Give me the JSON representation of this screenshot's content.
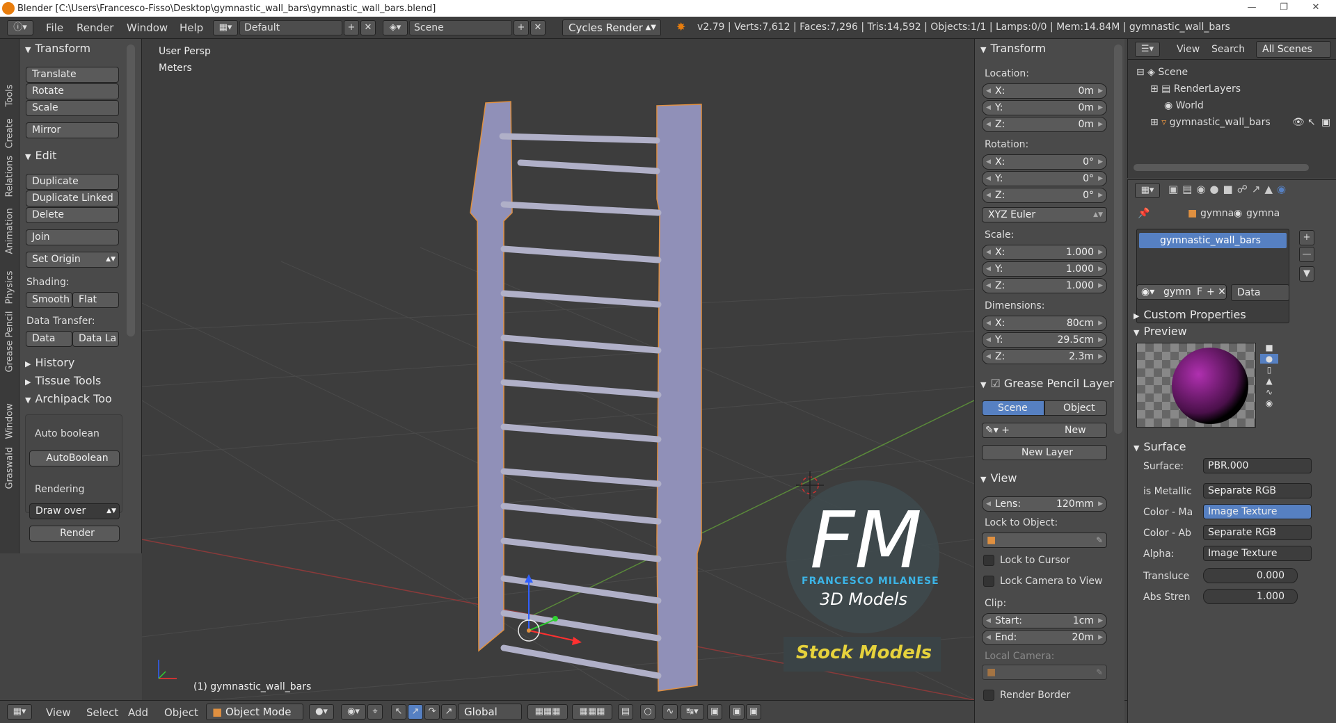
{
  "window": {
    "title": "Blender [C:\\Users\\Francesco-Fisso\\Desktop\\gymnastic_wall_bars\\gymnastic_wall_bars.blend]"
  },
  "menubar": {
    "items": [
      "File",
      "Render",
      "Window",
      "Help"
    ],
    "layout": "Default",
    "scene": "Scene",
    "engine": "Cycles Render",
    "stats": "v2.79 | Verts:7,612 | Faces:7,296 | Tris:14,592 | Objects:1/1 | Lamps:0/0 | Mem:14.84M | gymnastic_wall_bars"
  },
  "left_tabs": [
    "Tools",
    "Create",
    "Relations",
    "Animation",
    "Physics",
    "Grease Pencil",
    "Window",
    "Graswald"
  ],
  "tools": {
    "transform": {
      "title": "Transform",
      "buttons": [
        "Translate",
        "Rotate",
        "Scale",
        "Mirror"
      ]
    },
    "edit": {
      "title": "Edit",
      "buttons": [
        "Duplicate",
        "Duplicate Linked",
        "Delete",
        "Join",
        "Set Origin"
      ]
    },
    "shading": {
      "label": "Shading:",
      "smooth": "Smooth",
      "flat": "Flat"
    },
    "data_transfer": {
      "label": "Data Transfer:",
      "data": "Data",
      "data_layers": "Data La"
    },
    "history": "History",
    "tissue": "Tissue Tools",
    "archipack": "Archipack Too",
    "auto_boolean_label": "Auto boolean",
    "auto_boolean_btn": "AutoBoolean",
    "rendering_label": "Rendering",
    "draw_over": "Draw over",
    "render_btn": "Render"
  },
  "viewport": {
    "persp": "User Persp",
    "units": "Meters",
    "object_label": "(1) gymnastic_wall_bars",
    "watermark_line1": "FM",
    "watermark_line2": "FRANCESCO MILANESE",
    "watermark_line3": "3D Models",
    "watermark_line4": "Stock Models"
  },
  "bottom": {
    "items": [
      "View",
      "Select",
      "Add",
      "Object"
    ],
    "mode": "Object Mode",
    "orientation": "Global"
  },
  "npanel": {
    "transform_title": "Transform",
    "location_label": "Location:",
    "location": [
      {
        "k": "X:",
        "v": "0m"
      },
      {
        "k": "Y:",
        "v": "0m"
      },
      {
        "k": "Z:",
        "v": "0m"
      }
    ],
    "rotation_label": "Rotation:",
    "rotation": [
      {
        "k": "X:",
        "v": "0°"
      },
      {
        "k": "Y:",
        "v": "0°"
      },
      {
        "k": "Z:",
        "v": "0°"
      }
    ],
    "rotation_mode": "XYZ Euler",
    "scale_label": "Scale:",
    "scale": [
      {
        "k": "X:",
        "v": "1.000"
      },
      {
        "k": "Y:",
        "v": "1.000"
      },
      {
        "k": "Z:",
        "v": "1.000"
      }
    ],
    "dimensions_label": "Dimensions:",
    "dimensions": [
      {
        "k": "X:",
        "v": "80cm"
      },
      {
        "k": "Y:",
        "v": "29.5cm"
      },
      {
        "k": "Z:",
        "v": "2.3m"
      }
    ],
    "grease_title": "Grease Pencil Layer",
    "grease_scene": "Scene",
    "grease_object": "Object",
    "grease_new": "New",
    "grease_new_layer": "New Layer",
    "view_title": "View",
    "lens_label": "Lens:",
    "lens_value": "120mm",
    "lock_to_object": "Lock to Object:",
    "lock_cursor": "Lock to Cursor",
    "lock_camera": "Lock Camera to View",
    "clip_label": "Clip:",
    "clip_start_k": "Start:",
    "clip_start_v": "1cm",
    "clip_end_k": "End:",
    "clip_end_v": "20m",
    "local_camera": "Local Camera:",
    "render_border": "Render Border"
  },
  "outliner": {
    "view": "View",
    "search": "Search",
    "filter": "All Scenes",
    "items": [
      "Scene",
      "RenderLayers",
      "World",
      "gymnastic_wall_bars"
    ]
  },
  "properties": {
    "breadcrumb1": "gymna",
    "breadcrumb2": "gymna",
    "material_slot": "gymnastic_wall_bars",
    "mat_name": "gymn",
    "mat_f": "F",
    "mat_link": "Data",
    "custom_props": "Custom Properties",
    "preview": "Preview",
    "surface_title": "Surface",
    "surface_label": "Surface:",
    "surface_value": "PBR.000",
    "rows": [
      {
        "k": "is Metallic",
        "v": "Separate RGB"
      },
      {
        "k": "Color - Ma",
        "v": "Image Texture"
      },
      {
        "k": "Color - Ab",
        "v": "Separate RGB"
      },
      {
        "k": "Alpha:",
        "v": "Image Texture"
      }
    ],
    "translucency_k": "Transluce",
    "translucency_v": "0.000",
    "abs_k": "Abs Stren",
    "abs_v": "1.000"
  }
}
